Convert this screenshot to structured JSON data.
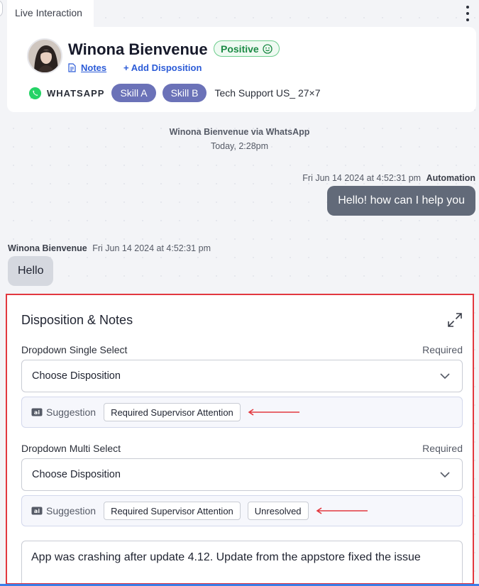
{
  "tab": {
    "title": "Live Interaction"
  },
  "contact": {
    "name": "Winona Bienvenue",
    "sentiment": "Positive",
    "notes_link": "Notes",
    "add_disposition_link": "+ Add Disposition",
    "channel": "WHATSAPP",
    "skills": [
      "Skill A",
      "Skill B"
    ],
    "queue": "Tech Support US_ 27×7"
  },
  "conversation": {
    "system": {
      "who": "Winona Bienvenue via WhatsApp",
      "when": "Today, 2:28pm"
    },
    "outgoing": {
      "timestamp": "Fri Jun 14 2024 at 4:52:31 pm",
      "sender": "Automation",
      "text": "Hello! how can I help you"
    },
    "incoming": {
      "sender": "Winona Bienvenue",
      "timestamp": "Fri Jun 14 2024 at 4:52:31 pm",
      "text": "Hello"
    }
  },
  "disposition": {
    "title": "Disposition & Notes",
    "single": {
      "label": "Dropdown Single Select",
      "required": "Required",
      "placeholder": "Choose Disposition",
      "suggestion_label": "Suggestion",
      "suggestions": [
        "Required Supervisor Attention"
      ]
    },
    "multi": {
      "label": "Dropdown Multi Select",
      "required": "Required",
      "placeholder": "Choose Disposition",
      "suggestion_label": "Suggestion",
      "suggestions": [
        "Required Supervisor Attention",
        "Unresolved"
      ]
    },
    "notes_text": "App was crashing after update 4.12. Update from the appstore fixed the issue"
  },
  "colors": {
    "highlight_border": "#e2383f",
    "skill_pill": "#6b72b8",
    "sentiment_green": "#1c8a45",
    "link_blue": "#2b5bd7",
    "outgoing_bubble": "#626a79"
  }
}
